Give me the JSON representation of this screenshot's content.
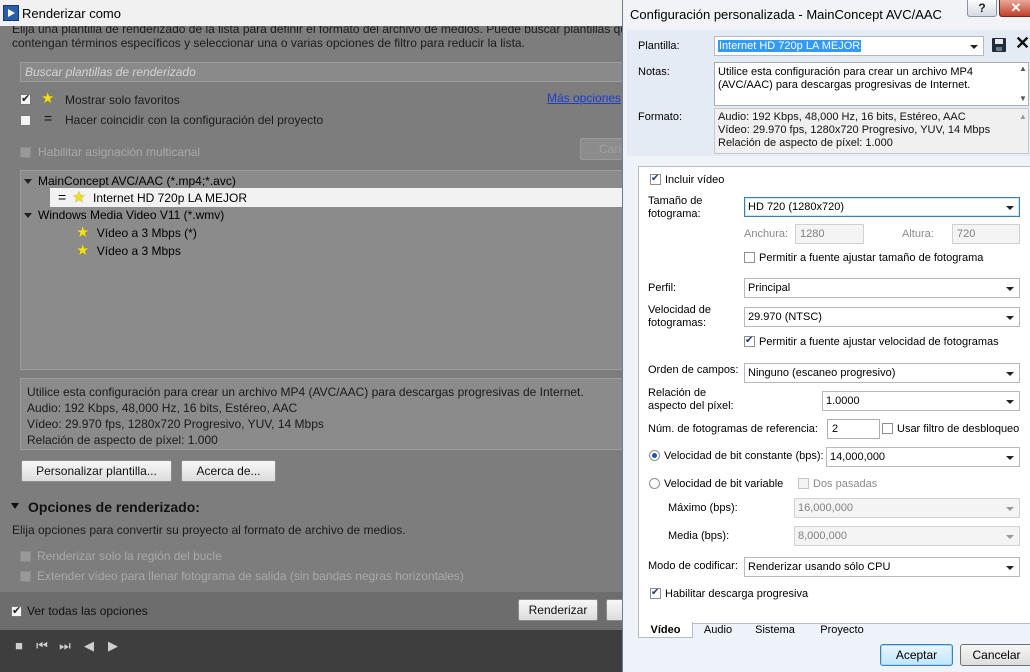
{
  "back_window": {
    "title": "Renderizar como",
    "intro_line1": "Elija una plantilla de renderizado de la lista para definir el formato del archivo de medios. Puede buscar plantillas que",
    "intro_line2": "contengan términos específicos y seleccionar una o varias opciones de filtro para reducir la lista.",
    "search_placeholder": "Buscar plantillas de renderizado",
    "show_favorites_label": "Mostrar solo favoritos",
    "show_favorites_checked": true,
    "more_options_link": "Más opciones",
    "match_project_label": "Hacer coincidir con la configuración del proyecto",
    "match_project_checked": false,
    "multichannel_label": "Habilitar asignación multicanal",
    "cancel_partial": "Canc",
    "tree": {
      "group1": "MainConcept AVC/AAC (*.mp4;*.avc)",
      "group1_item1": "Internet HD 720p LA MEJOR",
      "group2": "Windows Media Video V11 (*.wmv)",
      "group2_item1": "Vídeo a 3 Mbps (*)",
      "group2_item2": "Vídeo a 3 Mbps"
    },
    "description": {
      "line1": "Utilice esta configuración para crear un archivo MP4 (AVC/AAC) para descargas progresivas de Internet.",
      "line2": "Audio: 192 Kbps, 48,000 Hz, 16 bits, Estéreo, AAC",
      "line3": "Vídeo: 29.970 fps, 1280x720 Progresivo, YUV, 14 Mbps",
      "line4": "Relación de aspecto de píxel: 1.000"
    },
    "customize_button": "Personalizar plantilla...",
    "about_button": "Acerca de...",
    "render_options_heading": "Opciones de renderizado:",
    "render_options_desc": "Elija opciones para convertir su proyecto al formato de archivo de medios.",
    "loop_region_label": "Renderizar solo la región del bucle",
    "stretch_label": "Extender vídeo para llenar fotograma de salida (sin bandas negras horizontales)",
    "show_all_label": "Ver todas las opciones",
    "show_all_checked": true,
    "render_button": "Renderizar"
  },
  "dialog": {
    "title": "Configuración personalizada - MainConcept AVC/AAC",
    "help_label": "?",
    "template_label": "Plantilla:",
    "template_value": "Internet HD 720p LA MEJOR",
    "notes_label": "Notas:",
    "notes_text": "Utilice esta configuración para crear un archivo MP4 (AVC/AAC) para descargas progresivas de Internet.",
    "format_label": "Formato:",
    "format_line1": "Audio: 192 Kbps, 48,000 Hz, 16 bits, Estéreo, AAC",
    "format_line2": "Vídeo: 29.970 fps, 1280x720 Progresivo, YUV, 14 Mbps",
    "format_line3": "Relación de aspecto de píxel: 1.000",
    "include_video_label": "Incluir vídeo",
    "include_video_checked": true,
    "frame_size_label1": "Tamaño de",
    "frame_size_label2": "fotograma:",
    "frame_size_value": "HD 720 (1280x720)",
    "width_label": "Anchura:",
    "width_value": "1280",
    "height_label": "Altura:",
    "height_value": "720",
    "allow_frame_size_label": "Permitir a fuente ajustar tamaño de fotograma",
    "allow_frame_size_checked": false,
    "profile_label": "Perfil:",
    "profile_value": "Principal",
    "frame_rate_label1": "Velocidad de",
    "frame_rate_label2": "fotogramas:",
    "frame_rate_value": "29.970 (NTSC)",
    "allow_frame_rate_label": "Permitir a fuente ajustar velocidad de fotogramas",
    "allow_frame_rate_checked": true,
    "field_order_label": "Orden de campos:",
    "field_order_value": "Ninguno (escaneo progresivo)",
    "pixel_aspect_label1": "Relación de",
    "pixel_aspect_label2": "aspecto del píxel:",
    "pixel_aspect_value": "1.0000",
    "ref_frames_label": "Núm. de fotogramas de referencia:",
    "ref_frames_value": "2",
    "deblock_label": "Usar filtro de desbloqueo",
    "deblock_checked": false,
    "cbr_label": "Velocidad de bit constante (bps):",
    "cbr_selected": true,
    "cbr_value": "14,000,000",
    "vbr_label": "Velocidad de bit variable",
    "two_pass_label": "Dos pasadas",
    "max_label": "Máximo (bps):",
    "max_value": "16,000,000",
    "avg_label": "Media (bps):",
    "avg_value": "8,000,000",
    "encode_mode_label": "Modo de codificar:",
    "encode_mode_value": "Renderizar usando sólo CPU",
    "progressive_label": "Habilitar descarga progresiva",
    "progressive_checked": true,
    "tabs": [
      "Vídeo",
      "Audio",
      "Sistema",
      "Proyecto"
    ],
    "ok_button": "Aceptar",
    "cancel_button": "Cancelar"
  }
}
